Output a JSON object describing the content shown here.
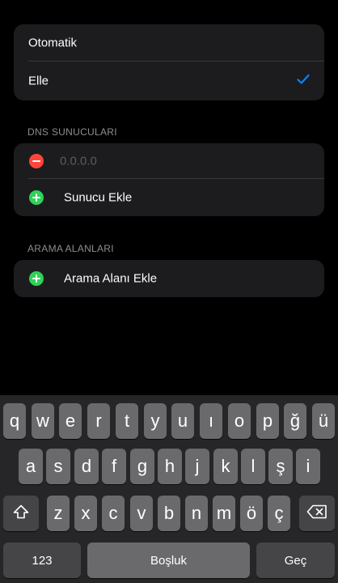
{
  "mode_options": [
    {
      "label": "Otomatik",
      "selected": false
    },
    {
      "label": "Elle",
      "selected": true
    }
  ],
  "dns": {
    "header": "DNS SUNUCULARI",
    "server_placeholder": "0.0.0.0",
    "add_label": "Sunucu Ekle"
  },
  "search_domains": {
    "header": "ARAMA ALANLARI",
    "add_label": "Arama Alanı Ekle"
  },
  "keyboard": {
    "row1": [
      "q",
      "w",
      "e",
      "r",
      "t",
      "y",
      "u",
      "ı",
      "o",
      "p",
      "ğ",
      "ü"
    ],
    "row2": [
      "a",
      "s",
      "d",
      "f",
      "g",
      "h",
      "j",
      "k",
      "l",
      "ş",
      "i"
    ],
    "row3": [
      "z",
      "x",
      "c",
      "v",
      "b",
      "n",
      "m",
      "ö",
      "ç"
    ],
    "numbers_label": "123",
    "space_label": "Boşluk",
    "go_label": "Geç"
  },
  "colors": {
    "accent": "#0a84ff",
    "remove": "#ff453a",
    "add": "#30d158"
  }
}
